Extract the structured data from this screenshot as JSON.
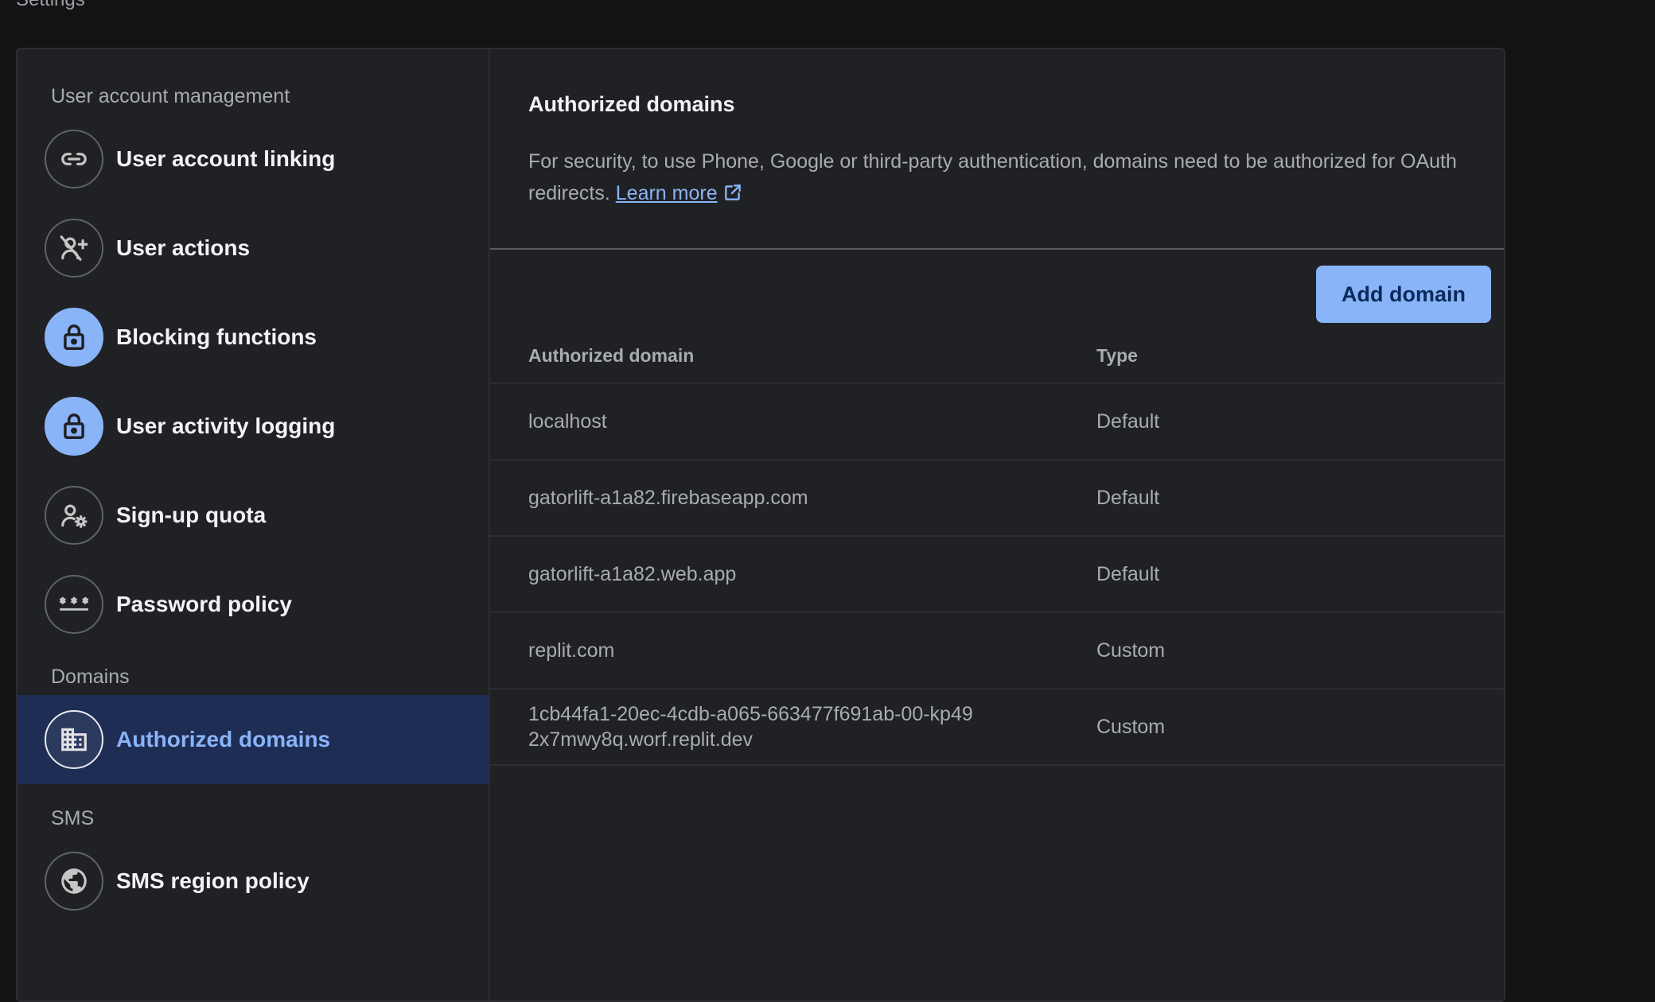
{
  "page": {
    "title": "Settings"
  },
  "sidebar": {
    "sections": [
      {
        "label": "User account management",
        "items": [
          {
            "label": "User account linking",
            "icon": "link-icon"
          },
          {
            "label": "User actions",
            "icon": "user-add-off-icon"
          },
          {
            "label": "Blocking functions",
            "icon": "lock-icon"
          },
          {
            "label": "User activity logging",
            "icon": "lock-icon"
          },
          {
            "label": "Sign-up quota",
            "icon": "user-settings-icon"
          },
          {
            "label": "Password policy",
            "icon": "password-icon"
          }
        ]
      },
      {
        "label": "Domains",
        "items": [
          {
            "label": "Authorized domains",
            "icon": "domain-icon",
            "active": true
          }
        ]
      },
      {
        "label": "SMS",
        "items": [
          {
            "label": "SMS region policy",
            "icon": "globe-icon"
          }
        ]
      }
    ]
  },
  "main": {
    "title": "Authorized domains",
    "description": "For security, to use Phone, Google or third-party authentication, domains need to be authorized for OAuth redirects.",
    "learn_more": "Learn more",
    "add_button": "Add domain",
    "table": {
      "columns": [
        "Authorized domain",
        "Type"
      ],
      "rows": [
        {
          "domain": "localhost",
          "type": "Default"
        },
        {
          "domain": "gatorlift-a1a82.firebaseapp.com",
          "type": "Default"
        },
        {
          "domain": "gatorlift-a1a82.web.app",
          "type": "Default"
        },
        {
          "domain": "replit.com",
          "type": "Custom"
        },
        {
          "domain": "1cb44fa1-20ec-4cdb-a065-663477f691ab-00-kp492x7mwy8q.worf.replit.dev",
          "type": "Custom"
        }
      ]
    }
  },
  "colors": {
    "accent": "#8ab4f8",
    "active_bg": "#1e2d54",
    "card_bg": "#202124",
    "page_bg": "#131314"
  }
}
